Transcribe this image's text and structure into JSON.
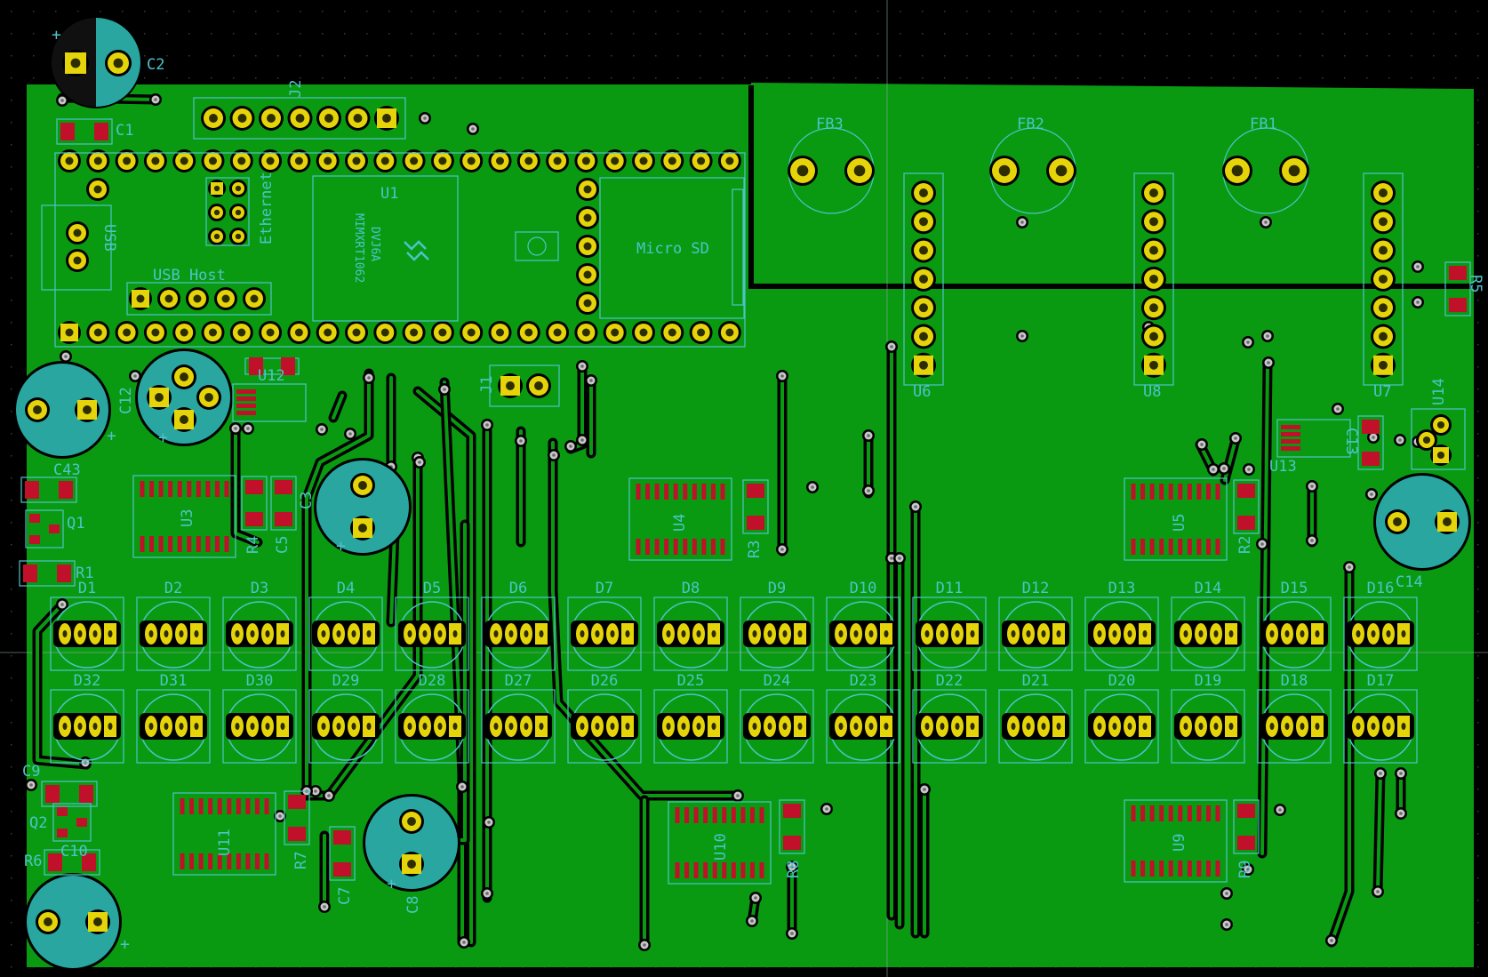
{
  "colors": {
    "background": "#000000",
    "copper_fill": "#0a9a12",
    "trace_clearance": "#000000",
    "pad_gold": "#e6d40a",
    "pad_smd": "#c0102a",
    "silkscreen": "#4fc3c9",
    "capacitor_body": "#2aa6a0",
    "outline": "#000000"
  },
  "labels": {
    "C2": "C2",
    "C1": "C1",
    "J2": "J2",
    "U1": "U1",
    "USB": "USB",
    "Ethernet": "Ethernet",
    "USBHost": "USB Host",
    "MicroSD": "Micro SD",
    "chip1": "MIMXRT1062",
    "chip2": "DVJ6A",
    "FB1": "FB1",
    "FB2": "FB2",
    "FB3": "FB3",
    "U6": "U6",
    "U7": "U7",
    "U8": "U8",
    "R5": "R5",
    "C12": "C12",
    "U12": "U12",
    "J1": "J1",
    "C13": "C13",
    "U13": "U13",
    "U14": "U14",
    "C43": "C43",
    "Q1": "Q1",
    "R1": "R1",
    "U3": "U3",
    "R4": "R4",
    "C5": "C5",
    "C3": "C3",
    "U4": "U4",
    "R3": "R3",
    "U5": "U5",
    "R2": "R2",
    "C14": "C14",
    "C9": "C9",
    "Q2": "Q2",
    "C10": "C10",
    "R6": "R6",
    "U11": "U11",
    "R7": "R7",
    "C7": "C7",
    "C8": "C8",
    "U10": "U10",
    "R8": "R8",
    "U9": "U9",
    "R9": "R9"
  },
  "leds_top": [
    "D1",
    "D2",
    "D3",
    "D4",
    "D5",
    "D6",
    "D7",
    "D8",
    "D9",
    "D10",
    "D11",
    "D12",
    "D13",
    "D14",
    "D15",
    "D16"
  ],
  "leds_bottom": [
    "D32",
    "D31",
    "D30",
    "D29",
    "D28",
    "D27",
    "D26",
    "D25",
    "D24",
    "D23",
    "D22",
    "D21",
    "D20",
    "D19",
    "D18",
    "D17"
  ]
}
